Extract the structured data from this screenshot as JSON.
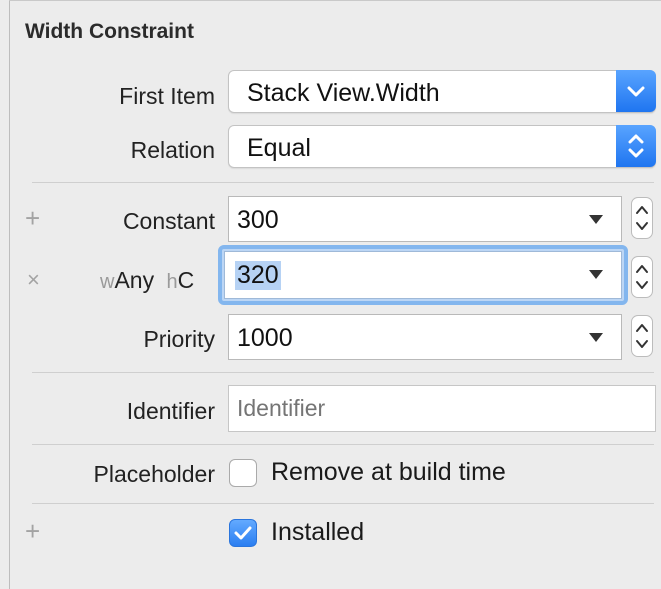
{
  "section_title": "Width Constraint",
  "first_item": {
    "label": "First Item",
    "value": "Stack View.Width"
  },
  "relation": {
    "label": "Relation",
    "value": "Equal"
  },
  "constant": {
    "label": "Constant",
    "value": "300"
  },
  "size_class_row": {
    "w_prefix": "w",
    "w_value": "Any",
    "h_prefix": "h",
    "h_value": "C",
    "value": "320"
  },
  "priority": {
    "label": "Priority",
    "value": "1000"
  },
  "identifier": {
    "label": "Identifier",
    "placeholder": "Identifier",
    "value": ""
  },
  "placeholder": {
    "label": "Placeholder",
    "checkbox_label": "Remove at build time",
    "checked": false
  },
  "installed": {
    "label": "Installed",
    "checked": true
  },
  "glyphs": {
    "plus": "+",
    "remove": "×"
  },
  "colors": {
    "accent": "#2a7ef1",
    "focus": "#83b6ee",
    "selection": "#bcd6f5"
  }
}
